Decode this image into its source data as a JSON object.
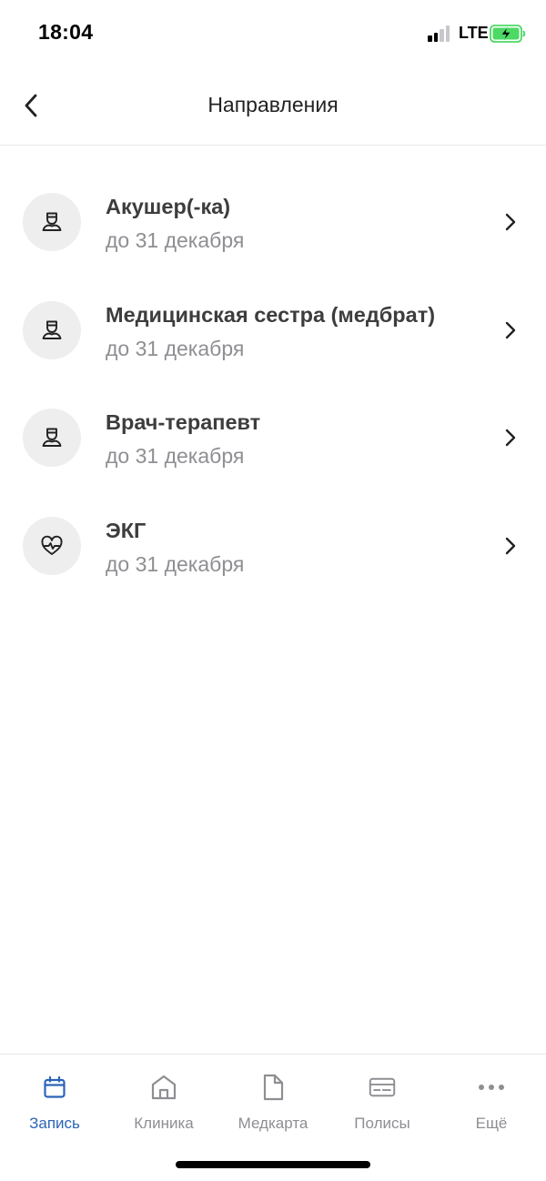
{
  "status_bar": {
    "time": "18:04",
    "network": "LTE",
    "signal_icon": "signal-bars-icon",
    "battery_icon": "battery-charging-icon",
    "battery_color": "#4cd964"
  },
  "header": {
    "title": "Направления",
    "back_icon": "chevron-left-icon"
  },
  "referrals": [
    {
      "title": "Акушер(-ка)",
      "subtitle": "до 31 декабря",
      "icon": "doctor-icon"
    },
    {
      "title": "Медицинская сестра (медбрат)",
      "subtitle": "до 31 декабря",
      "icon": "doctor-icon"
    },
    {
      "title": "Врач-терапевт",
      "subtitle": "до 31 декабря",
      "icon": "doctor-icon"
    },
    {
      "title": "ЭКГ",
      "subtitle": "до 31 декабря",
      "icon": "heart-pulse-icon"
    }
  ],
  "tab_bar": {
    "accent_color": "#2b64b8",
    "inactive_color": "#8e8e93",
    "active_tab": "Запись",
    "tabs": [
      {
        "label": "Запись",
        "icon": "calendar-icon"
      },
      {
        "label": "Клиника",
        "icon": "home-icon"
      },
      {
        "label": "Медкарта",
        "icon": "document-icon"
      },
      {
        "label": "Полисы",
        "icon": "card-icon"
      },
      {
        "label": "Ещё",
        "icon": "more-icon"
      }
    ]
  }
}
